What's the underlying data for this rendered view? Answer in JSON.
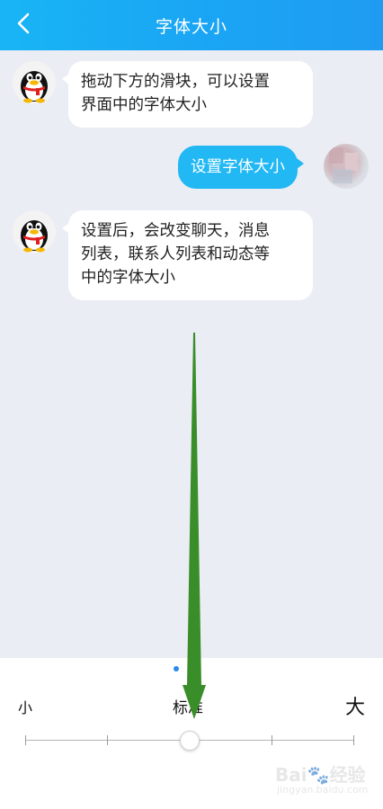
{
  "header": {
    "title": "字体大小"
  },
  "messages": [
    {
      "side": "left",
      "lines": [
        "拖动下方的滑块，可以设置",
        "界面中的字体大小"
      ]
    },
    {
      "side": "right",
      "lines": [
        "设置字体大小"
      ]
    },
    {
      "side": "left",
      "lines": [
        "设置后，会改变聊天，消息",
        "列表，联系人列表和动态等",
        "中的字体大小"
      ]
    }
  ],
  "font_panel": {
    "label_small": "小",
    "label_standard": "标准",
    "label_large": "大",
    "slider": {
      "steps": 5,
      "selected_index": 2
    }
  },
  "watermark": {
    "text": "Bai🐾经验",
    "sub": "jingyan.baidu.com"
  },
  "colors": {
    "header": "#1aa6f4",
    "bubble_right": "#21b8f4",
    "chat_bg": "#ebedf5",
    "arrow": "#3a8e2a",
    "page_dot": "#2c8ae8"
  }
}
